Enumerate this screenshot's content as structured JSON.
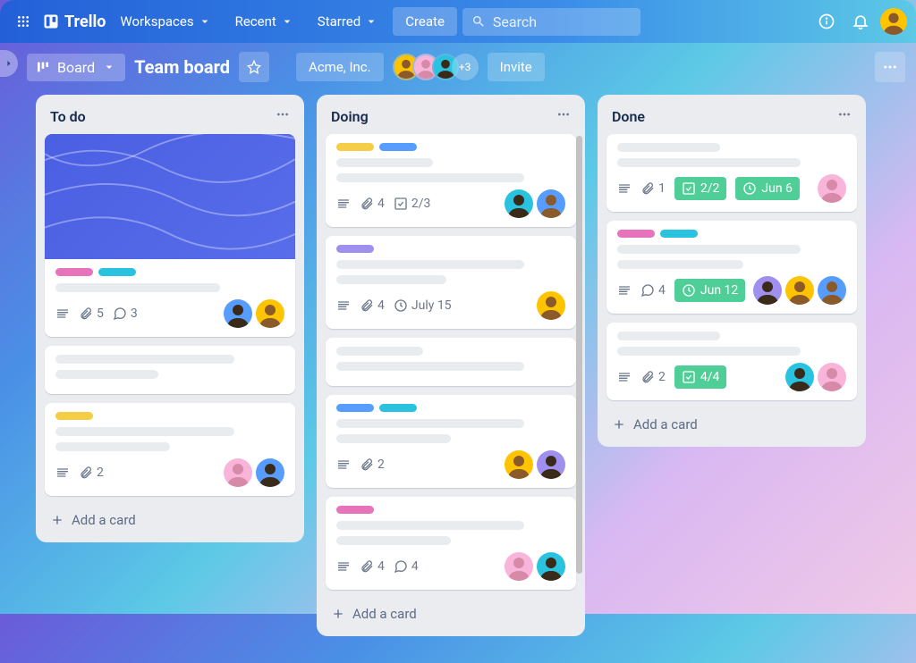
{
  "brand": "Trello",
  "nav": {
    "workspaces": "Workspaces",
    "recent": "Recent",
    "starred": "Starred",
    "create": "Create"
  },
  "search": {
    "placeholder": "Search"
  },
  "board": {
    "view_label": "Board",
    "title": "Team board",
    "workspace": "Acme, Inc.",
    "plus_members": "+3",
    "invite": "Invite"
  },
  "colors": {
    "yellow": "#f5cd47",
    "blue": "#579dff",
    "cyan": "#29c3e0",
    "pink": "#e774bb",
    "purple": "#9f8fef",
    "green": "#4fce97"
  },
  "lists": [
    {
      "title": "To do",
      "add_label": "Add a card",
      "cards": [
        {
          "cover": true,
          "labels": [
            "pink",
            "cyan"
          ],
          "skeletons": [
            0.72
          ],
          "badges": {
            "desc": true,
            "attachments": 5,
            "comments": 3
          },
          "members": [
            "dark-blue",
            "yellow-yellow"
          ]
        },
        {
          "labels": [],
          "skeletons": [
            0.78,
            0.45
          ],
          "badges": {},
          "members": []
        },
        {
          "labels": [
            "yellow"
          ],
          "skeletons": [
            0.78,
            0.5
          ],
          "badges": {
            "desc": true,
            "attachments": 2
          },
          "members": [
            "pink-pink",
            "dark-blue"
          ]
        }
      ]
    },
    {
      "title": "Doing",
      "add_label": "Add a card",
      "scroll": true,
      "cards": [
        {
          "labels": [
            "yellow",
            "blue"
          ],
          "skeletons": [
            0.42,
            0.82
          ],
          "badges": {
            "desc": true,
            "checklist": "2/3",
            "attachments": 4
          },
          "members": [
            "dark-cyan",
            "brown-blue"
          ]
        },
        {
          "labels": [
            "purple"
          ],
          "skeletons": [
            0.82,
            0.48
          ],
          "badges": {
            "desc": true,
            "attachments": 4,
            "due": "July 15"
          },
          "members": [
            "yellow-yellow"
          ]
        },
        {
          "labels": [],
          "skeletons": [
            0.38,
            0.82
          ],
          "badges": {},
          "members": []
        },
        {
          "labels": [
            "blue",
            "cyan"
          ],
          "skeletons": [
            0.82,
            0.5
          ],
          "badges": {
            "desc": true,
            "attachments": 2
          },
          "members": [
            "yellow-yellow",
            "dark-purple"
          ]
        },
        {
          "labels": [
            "pink"
          ],
          "skeletons": [
            0.82,
            0.5
          ],
          "badges": {
            "desc": true,
            "attachments": 4,
            "comments": 4
          },
          "members": [
            "pink-pink",
            "dark-cyan"
          ]
        }
      ]
    },
    {
      "title": "Done",
      "add_label": "Add a card",
      "cards": [
        {
          "labels": [],
          "skeletons": [
            0.45,
            0.8
          ],
          "badges": {
            "desc": true,
            "attachments": 1,
            "checklist_done": "2/2",
            "due_done": "Jun 6"
          },
          "members": [
            "pink-pink"
          ]
        },
        {
          "labels": [
            "pink",
            "cyan"
          ],
          "skeletons": [
            0.8,
            0.55
          ],
          "badges": {
            "desc": true,
            "comments": 4,
            "due_done": "Jun 12"
          },
          "members": [
            "dark-purple",
            "yellow-yellow",
            "brown-blue"
          ]
        },
        {
          "labels": [],
          "skeletons": [
            0.45,
            0.8
          ],
          "badges": {
            "desc": true,
            "attachments": 2,
            "checklist_done": "4/4"
          },
          "members": [
            "dark-cyan",
            "pink-pink"
          ]
        }
      ]
    }
  ]
}
